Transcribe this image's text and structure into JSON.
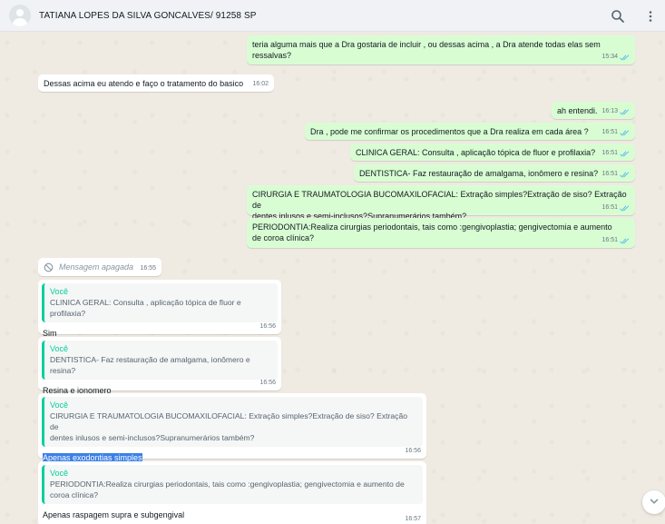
{
  "header": {
    "contact_name": "TATIANA LOPES DA SILVA GONCALVES/ 91258 SP",
    "search_icon": "search-icon",
    "menu_icon": "more-vertical-icon"
  },
  "colors": {
    "outgoing_bubble": "#d9fdd3",
    "incoming_bubble": "#ffffff",
    "quote_accent": "#06cf9c",
    "read_ticks": "#53bdeb",
    "selection": "#3b80e6"
  },
  "messages": [
    {
      "text": "teria alguma mais que a Dra gostaria de incluir , ou dessas acima , a Dra atende todas elas sem\nressalvas?",
      "time": "15:34"
    },
    {
      "text": "Dessas acima eu atendo e faço o tratamento do basico",
      "time": "16:02"
    },
    {
      "text": "ah entendi.",
      "time": "16:13"
    },
    {
      "text": "Dra , pode me confirmar os procedimentos que a Dra realiza em cada área ?",
      "time": "16:51"
    },
    {
      "text": "CLINICA GERAL: Consulta , aplicação tópica de fluor e profilaxia?",
      "time": "16:51"
    },
    {
      "text": "DENTISTICA- Faz restauração de amalgama, ionômero e resina?",
      "time": "16:51"
    },
    {
      "text": "CIRURGIA E TRAUMATOLOGIA BUCOMAXILOFACIAL: Extração simples?Extração de siso? Extração de\ndentes inlusos e semi-inclusos?Supranumerários também?",
      "time": "16:51"
    },
    {
      "text": "PERIODONTIA:Realiza cirurgias periodontais, tais como :gengivoplastia; gengivectomia e aumento\nde coroa clínica?",
      "time": "16:51"
    },
    {
      "text": "Mensagem apagada",
      "time": "16:55"
    },
    {
      "quote_author": "Você",
      "quote_text": "CLINICA GERAL: Consulta , aplicação tópica de fluor e profilaxia?",
      "text": "Sim",
      "time": "16:56"
    },
    {
      "quote_author": "Você",
      "quote_text": "DENTISTICA- Faz restauração de amalgama, ionômero e resina?",
      "text": "Resina e ionomero",
      "time": "16:56"
    },
    {
      "quote_author": "Você",
      "quote_text": "CIRURGIA E TRAUMATOLOGIA BUCOMAXILOFACIAL: Extração simples?Extração de siso? Extração de\ndentes inlusos e semi-inclusos?Supranumerários também?",
      "text": "Apenas exodontias simples",
      "time": "16:56"
    },
    {
      "quote_author": "Você",
      "quote_text": "PERIODONTIA:Realiza cirurgias periodontais, tais como :gengivoplastia; gengivectomia e aumento de\ncoroa clínica?",
      "text": "Apenas raspagem supra e subgengival",
      "time": "16:57"
    }
  ]
}
